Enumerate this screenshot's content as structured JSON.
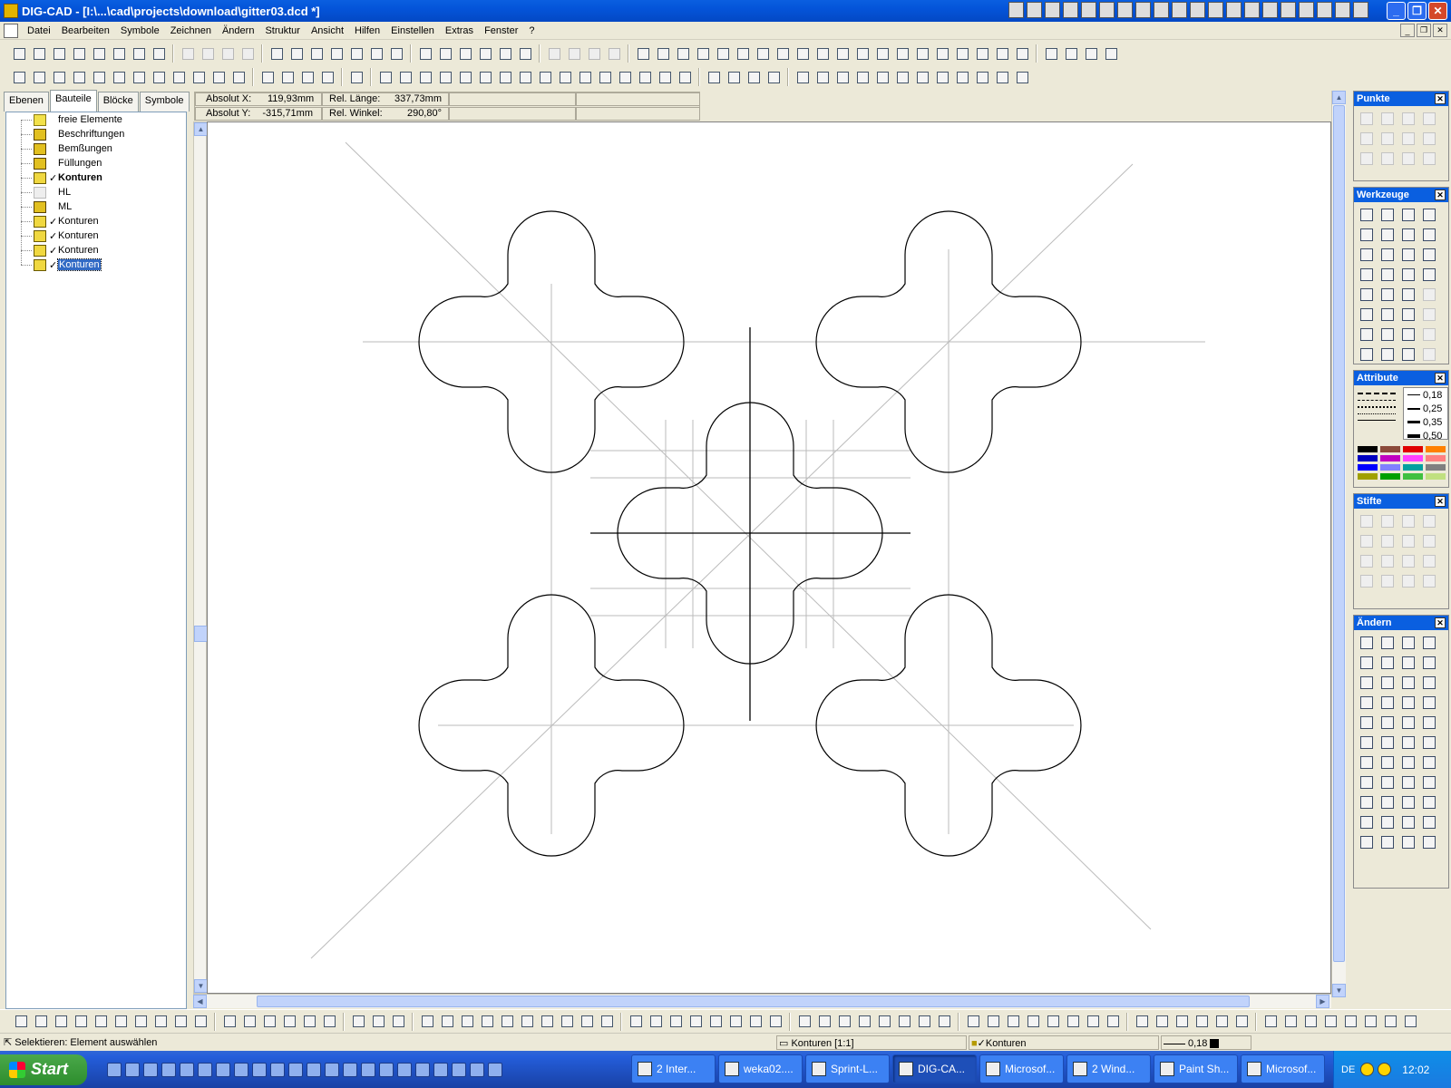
{
  "window": {
    "title": "DIG-CAD - [I:\\...\\cad\\projects\\download\\gitter03.dcd *]"
  },
  "menu": [
    "Datei",
    "Bearbeiten",
    "Symbole",
    "Zeichnen",
    "Ändern",
    "Struktur",
    "Ansicht",
    "Hilfen",
    "Einstellen",
    "Extras",
    "Fenster",
    "?"
  ],
  "left_tabs": [
    "Ebenen",
    "Bauteile",
    "Blöcke",
    "Symbole"
  ],
  "active_tab": "Bauteile",
  "tree": [
    {
      "label": "freie Elemente",
      "icon": "folder-icon",
      "checked": false,
      "bold": false,
      "selected": false
    },
    {
      "label": "Beschriftungen",
      "icon": "tools-icon",
      "checked": false,
      "bold": false,
      "selected": false
    },
    {
      "label": "Bemßungen",
      "icon": "tools-icon",
      "checked": false,
      "bold": false,
      "selected": false
    },
    {
      "label": "Füllungen",
      "icon": "tools-icon",
      "checked": false,
      "bold": false,
      "selected": false
    },
    {
      "label": "Konturen",
      "icon": "cube-icon",
      "checked": true,
      "bold": true,
      "selected": false
    },
    {
      "label": "HL",
      "icon": "pale-tools-icon",
      "checked": false,
      "bold": false,
      "selected": false
    },
    {
      "label": "ML",
      "icon": "tools-icon",
      "checked": false,
      "bold": false,
      "selected": false
    },
    {
      "label": "Konturen",
      "icon": "cube-icon",
      "checked": true,
      "bold": false,
      "selected": false
    },
    {
      "label": "Konturen",
      "icon": "cube-icon",
      "checked": true,
      "bold": false,
      "selected": false
    },
    {
      "label": "Konturen",
      "icon": "cube-icon",
      "checked": true,
      "bold": false,
      "selected": false
    },
    {
      "label": "Konturen",
      "icon": "cube-icon",
      "checked": true,
      "bold": false,
      "selected": false
    }
  ],
  "coords": {
    "abs_x_label": "Absolut X:",
    "abs_x": "119,93mm",
    "abs_y_label": "Absolut Y:",
    "abs_y": "-315,71mm",
    "rel_len_label": "Rel. Länge:",
    "rel_len": "337,73mm",
    "rel_angle_label": "Rel. Winkel:",
    "rel_angle": "290,80°"
  },
  "panels": {
    "punkte": "Punkte",
    "werkzeuge": "Werkzeuge",
    "attribute": "Attribute",
    "stifte": "Stifte",
    "aendern": "Ändern",
    "werkzeuge_edit1": "Edit",
    "werkzeuge_edit2": "Edit"
  },
  "line_widths": [
    "0,18",
    "0,25",
    "0,35",
    "0,50"
  ],
  "palette": [
    "#000000",
    "#8b4a3a",
    "#e00000",
    "#ff8000",
    "#0000c0",
    "#c000c0",
    "#ff40ff",
    "#ff8080",
    "#0000ff",
    "#8080ff",
    "#00a0a0",
    "#808080",
    "#a0a000",
    "#00a000",
    "#40c040",
    "#c0e080"
  ],
  "status": {
    "hint": "Selektieren: Element auswählen",
    "layer": "Konturen [1:1]",
    "part": "Konturen",
    "pen_width": "0,18"
  },
  "taskbar": {
    "start": "Start",
    "buttons": [
      {
        "label": "2 Inter...",
        "active": false
      },
      {
        "label": "weka02....",
        "active": false
      },
      {
        "label": "Sprint-L...",
        "active": false
      },
      {
        "label": "DIG-CA...",
        "active": true
      },
      {
        "label": "Microsof...",
        "active": false
      },
      {
        "label": "2 Wind...",
        "active": false
      },
      {
        "label": "Paint Sh...",
        "active": false
      },
      {
        "label": "Microsof...",
        "active": false
      }
    ],
    "lang": "DE",
    "clock": "12:02"
  }
}
